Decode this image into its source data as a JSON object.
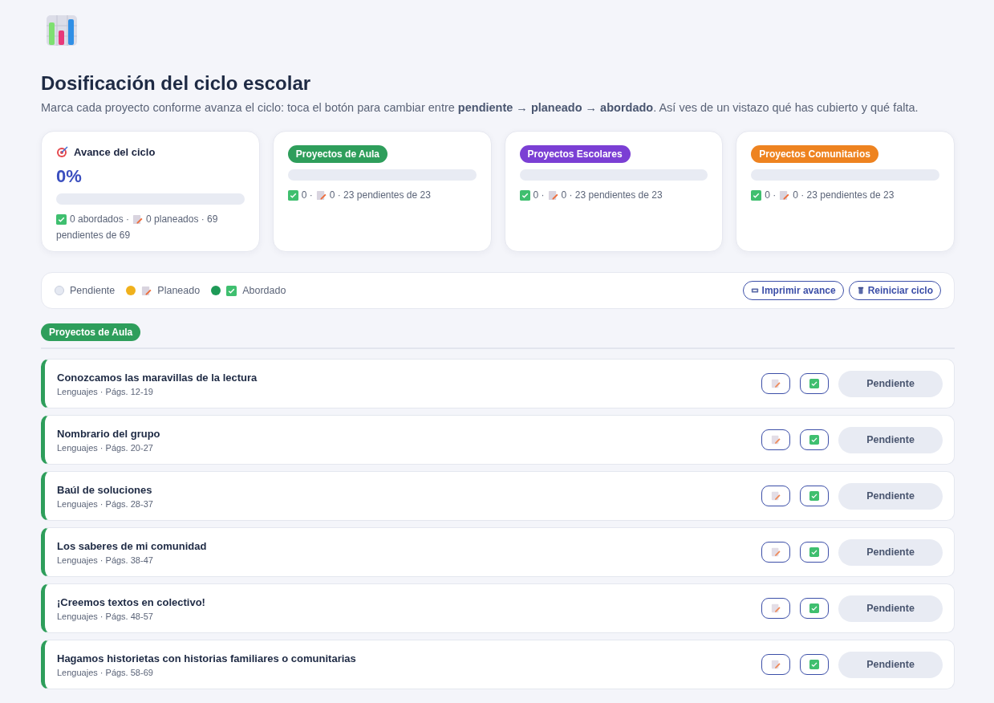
{
  "header": {
    "title": "Dosificación del ciclo escolar",
    "subtitle": "Marca cada proyecto conforme avanza el ciclo: toca el botón para cambiar entre **pendiente → planeado → abordado**. Así ves de un vistazo qué has cubierto y qué falta."
  },
  "summary": {
    "title": "Avance del ciclo",
    "percent": "0%",
    "level": 0,
    "done": "0 abordados ·",
    "planned": "0 planeados · 69",
    "remaining": "pendientes de 69"
  },
  "categories": [
    {
      "label": "Proyectos de Aula",
      "color": "#2e9e5b",
      "level": 0,
      "done": "0 ·",
      "rest": "0 · 23 pendientes de 23"
    },
    {
      "label": "Proyectos Escolares",
      "color": "#7b3fd4",
      "level": 0,
      "done": "0 ·",
      "rest": "0 · 23 pendientes de 23"
    },
    {
      "label": "Proyectos Comunitarios",
      "color": "#ee8320",
      "level": 0,
      "done": "0 ·",
      "rest": "0 · 23 pendientes de 23"
    }
  ],
  "legend": [
    {
      "label": "Pendiente",
      "color": "#e5e9f2",
      "kind": "pending"
    },
    {
      "label": "Planeado",
      "color": "#f0b11c",
      "kind": "planned"
    },
    {
      "label": "Abordado",
      "color": "#1e9a57",
      "kind": "done"
    }
  ],
  "actions": [
    {
      "label": "Imprimir avance",
      "kind": "print"
    },
    {
      "label": "Reiniciar ciclo",
      "kind": "reset"
    }
  ],
  "section": {
    "label": "Proyectos de Aula",
    "color": "#2e9e5b"
  },
  "projects": [
    {
      "title": "Conozcamos las maravillas de la lectura",
      "meta": "Lenguajes · Págs. 12-19",
      "status": {
        "kind": "pending",
        "label": "Pendiente"
      }
    },
    {
      "title": "Nombrario del grupo",
      "meta": "Lenguajes · Págs. 20-27",
      "status": {
        "kind": "pending",
        "label": "Pendiente"
      }
    },
    {
      "title": "Baúl de soluciones",
      "meta": "Lenguajes · Págs. 28-37",
      "status": {
        "kind": "pending",
        "label": "Pendiente"
      }
    },
    {
      "title": "Los saberes de mi comunidad",
      "meta": "Lenguajes · Págs. 38-47",
      "status": {
        "kind": "pending",
        "label": "Pendiente"
      }
    },
    {
      "title": "¡Creemos textos en colectivo!",
      "meta": "Lenguajes · Págs. 48-57",
      "status": {
        "kind": "pending",
        "label": "Pendiente"
      }
    },
    {
      "title": "Hagamos historietas con historias familiares o comunitarias",
      "meta": "Lenguajes · Págs. 58-69",
      "status": {
        "kind": "pending",
        "label": "Pendiente"
      }
    }
  ]
}
